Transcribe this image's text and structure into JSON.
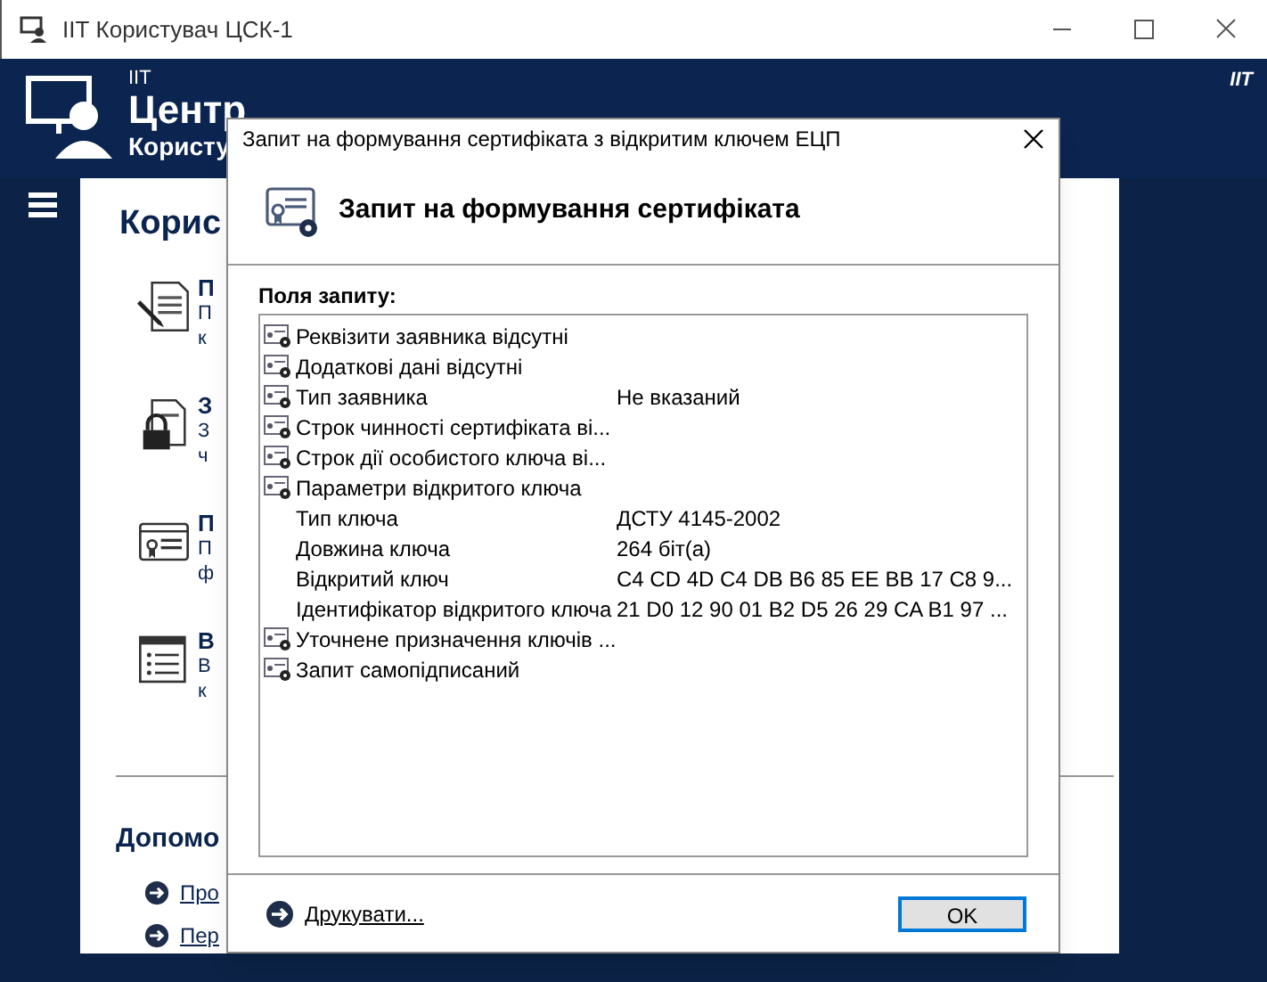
{
  "window": {
    "title": "ІІТ Користувач ЦСК-1",
    "brand": "IIT"
  },
  "header": {
    "caption": "IIT",
    "title": "Центр",
    "subtitle": "Користу"
  },
  "content": {
    "heading": "Корис",
    "items": [
      {
        "title": "П",
        "lines": [
          "П",
          "к"
        ],
        "kind": "document"
      },
      {
        "title": "З",
        "lines": [
          "З",
          "ч"
        ],
        "kind": "lock"
      },
      {
        "title": "П",
        "lines": [
          "П",
          "ф"
        ],
        "kind": "certificate"
      },
      {
        "title": "В",
        "lines": [
          "В",
          "к"
        ],
        "kind": "list"
      }
    ],
    "help": {
      "heading": "Допомо",
      "links": [
        "Про",
        "Пер"
      ]
    }
  },
  "dialog": {
    "title": "Запит на формування сертифіката з відкритим ключем ЕЦП",
    "heading": "Запит на формування сертифіката",
    "fields_label": "Поля запиту:",
    "fields": [
      {
        "name": "Реквізити заявника відсутні"
      },
      {
        "name": "Додаткові дані відсутні"
      },
      {
        "name": "Тип заявника",
        "value": "Не вказаний"
      },
      {
        "name": "Строк чинності сертифіката ві..."
      },
      {
        "name": "Строк дії особистого ключа ві..."
      },
      {
        "name": "Параметри відкритого ключа",
        "children": [
          {
            "name": "Тип ключа",
            "value": "ДСТУ 4145-2002"
          },
          {
            "name": "Довжина ключа",
            "value": "264 біт(а)"
          },
          {
            "name": "Відкритий ключ",
            "value": "C4 CD 4D C4 DB B6 85 EE BB 17 C8 9..."
          },
          {
            "name": "Ідентифікатор відкритого ключа",
            "value": "21 D0 12 90 01 B2 D5 26 29 CA B1 97 ..."
          }
        ]
      },
      {
        "name": "Уточнене призначення ключів ..."
      },
      {
        "name": "Запит самопідписаний"
      }
    ],
    "print_link": "Друкувати...",
    "ok_button": "OK"
  }
}
